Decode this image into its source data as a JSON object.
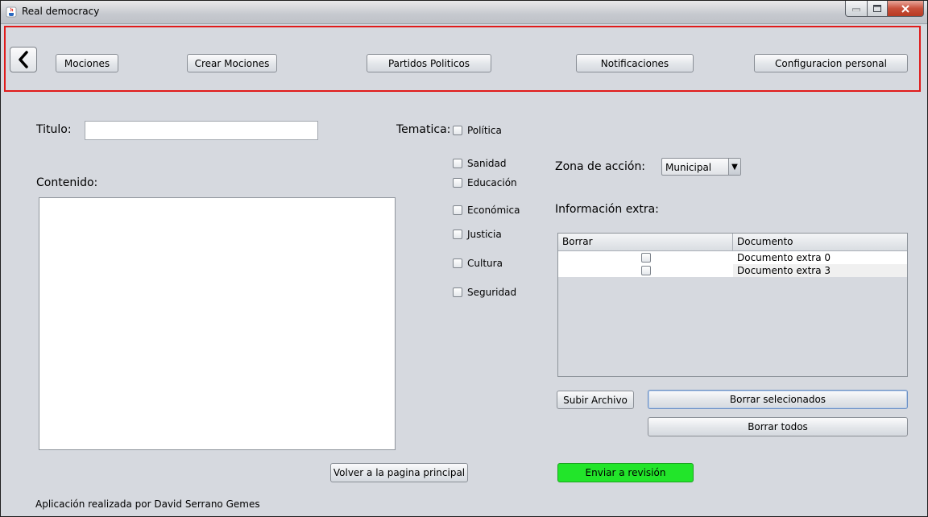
{
  "window": {
    "title": "Real democracy"
  },
  "nav": {
    "back_icon": "chevron-left-icon",
    "items": [
      {
        "label": "Mociones"
      },
      {
        "label": "Crear Mociones"
      },
      {
        "label": "Partidos Politicos"
      },
      {
        "label": "Notificaciones"
      },
      {
        "label": "Configuracion personal"
      }
    ]
  },
  "form": {
    "title_label": "Titulo:",
    "title_value": "",
    "content_label": "Contenido:",
    "tematica_label": "Tematica:",
    "tematica_options": [
      {
        "label": "Política",
        "checked": false
      },
      {
        "label": "Sanidad",
        "checked": false
      },
      {
        "label": "Educación",
        "checked": false
      },
      {
        "label": "Económica",
        "checked": false
      },
      {
        "label": "Justicia",
        "checked": false
      },
      {
        "label": "Cultura",
        "checked": false
      },
      {
        "label": "Seguridad",
        "checked": false
      }
    ],
    "zona_label": "Zona de acción:",
    "zona_selected": "Municipal",
    "extra_label": "Información extra:"
  },
  "table": {
    "columns": [
      "Borrar",
      "Documento"
    ],
    "rows": [
      {
        "borrar": false,
        "documento": "Documento extra 0"
      },
      {
        "borrar": false,
        "documento": "Documento extra 3"
      }
    ]
  },
  "actions": {
    "upload": "Subir Archivo",
    "delete_selected": "Borrar selecionados",
    "delete_all": "Borrar todos",
    "home": "Volver a la pagina principal",
    "submit": "Enviar a revisión"
  },
  "footer": {
    "credit": "Aplicación realizada por David Serrano Gemes"
  },
  "colors": {
    "nav_border": "#e01b1b",
    "submit_bg": "#22e52a",
    "window_bg": "#d6d9df"
  }
}
